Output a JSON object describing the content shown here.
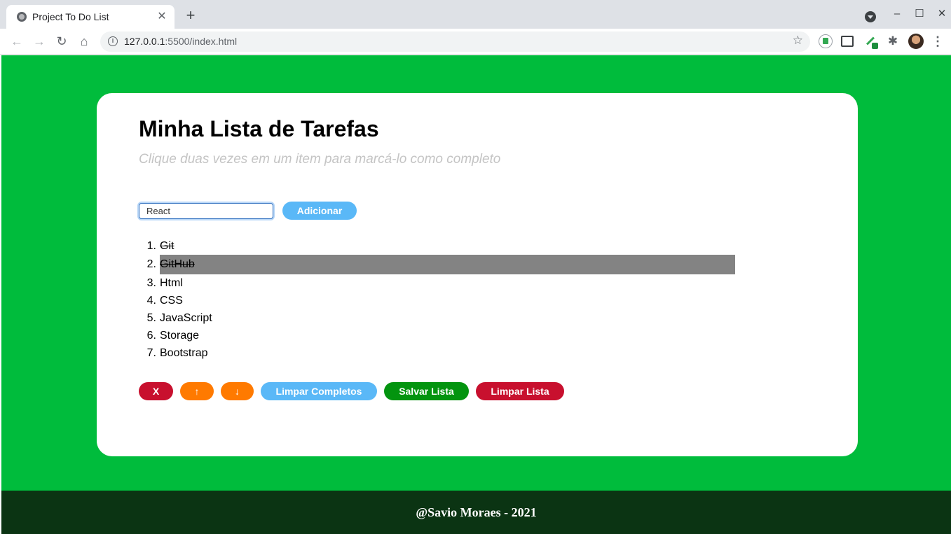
{
  "browser": {
    "tab_title": "Project To Do List",
    "tab_close": "✕",
    "new_tab": "+",
    "url_host": "127.0.0.1",
    "url_path": ":5500/index.html",
    "window_minimize": "–",
    "window_maximize": "☐",
    "window_close": "✕"
  },
  "app": {
    "title": "Minha Lista de Tarefas",
    "subtitle": "Clique duas vezes em um item para marcá-lo como completo",
    "input_value": "React",
    "add_label": "Adicionar",
    "tasks": [
      {
        "num": "1.",
        "text": "Git",
        "completed": true,
        "selected": false
      },
      {
        "num": "2.",
        "text": "GitHub",
        "completed": true,
        "selected": true
      },
      {
        "num": "3.",
        "text": "Html",
        "completed": false,
        "selected": false
      },
      {
        "num": "4.",
        "text": "CSS",
        "completed": false,
        "selected": false
      },
      {
        "num": "5.",
        "text": "JavaScript",
        "completed": false,
        "selected": false
      },
      {
        "num": "6.",
        "text": "Storage",
        "completed": false,
        "selected": false
      },
      {
        "num": "7.",
        "text": "Bootstrap",
        "completed": false,
        "selected": false
      }
    ],
    "buttons": {
      "remove": "X",
      "move_up": "↑",
      "move_down": "↓",
      "clear_completed": "Limpar Completos",
      "save_list": "Salvar Lista",
      "clear_list": "Limpar Lista"
    }
  },
  "footer": {
    "text": "@Savio Moraes - 2021"
  },
  "colors": {
    "page_background": "#00bc3c",
    "footer_background": "#0b3413",
    "button_red": "#c8102e",
    "button_orange": "#ff7a00",
    "button_blue": "#5ab8f7",
    "button_green": "#03940f",
    "selected_row": "#838383"
  }
}
